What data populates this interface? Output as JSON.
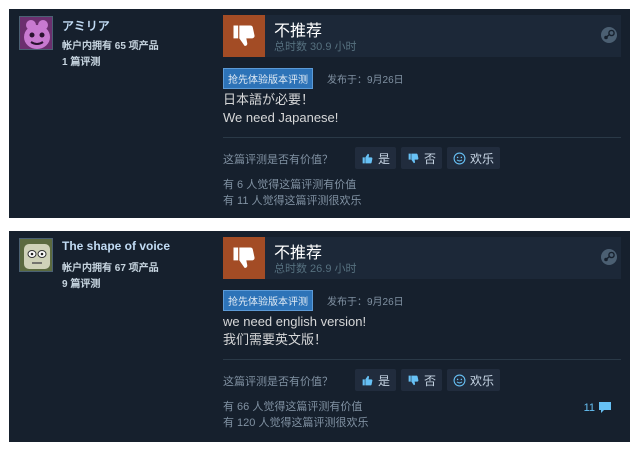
{
  "reviews": [
    {
      "author": {
        "name": "アミリア",
        "products": "帐户内拥有 65 项产品",
        "review_count": "1 篇评测"
      },
      "verdict": "不推荐",
      "hours": "总时数 30.9 小时",
      "badge": "抢先体验版本评测",
      "posted": "发布于：9月26日",
      "content_lines": [
        "日本語が必要！",
        "We need Japanese!"
      ],
      "helpful_question": "这篇评测是否有价值？",
      "buttons": {
        "yes": "是",
        "no": "否",
        "funny": "欢乐"
      },
      "stats": [
        "有 6 人觉得这篇评测有价值",
        "有 11 人觉得这篇评测很欢乐"
      ],
      "comments": ""
    },
    {
      "author": {
        "name": "The shape of voice",
        "products": "帐户内拥有 67 项产品",
        "review_count": "9 篇评测"
      },
      "verdict": "不推荐",
      "hours": "总时数 26.9 小时",
      "badge": "抢先体验版本评测",
      "posted": "发布于：9月26日",
      "content_lines": [
        "we need english version!",
        "我们需要英文版！"
      ],
      "helpful_question": "这篇评测是否有价值？",
      "buttons": {
        "yes": "是",
        "no": "否",
        "funny": "欢乐"
      },
      "stats": [
        "有 66 人觉得这篇评测有价值",
        "有 120 人觉得这篇评测很欢乐"
      ],
      "comments": "11"
    }
  ],
  "icons": {
    "thumb": "thumbs-down-icon",
    "steam": "steam-icon",
    "comment": "comment-icon"
  },
  "colors": {
    "panel": "#16202d",
    "thumb_down": "#a34c25",
    "link": "#66c0f4"
  }
}
